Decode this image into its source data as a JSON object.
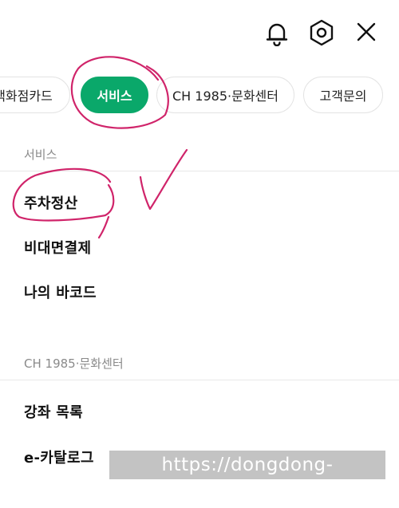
{
  "header": {
    "icons": {
      "bell": "bell-icon",
      "settings": "hexagon-settings-icon",
      "close": "close-icon"
    }
  },
  "tabs": [
    {
      "label": "백화점카드",
      "active": false
    },
    {
      "label": "서비스",
      "active": true
    },
    {
      "label": "CH 1985·문화센터",
      "active": false
    },
    {
      "label": "고객문의",
      "active": false
    }
  ],
  "sections": [
    {
      "title": "서비스",
      "items": [
        "주차정산",
        "비대면결제",
        "나의 바코드"
      ]
    },
    {
      "title": "CH 1985·문화센터",
      "items": [
        "강좌 목록",
        "e-카탈로그"
      ]
    }
  ],
  "watermark": "https://dongdong-chance.com",
  "colors": {
    "accent": "#0aa86a",
    "annotation": "#d0246a"
  }
}
